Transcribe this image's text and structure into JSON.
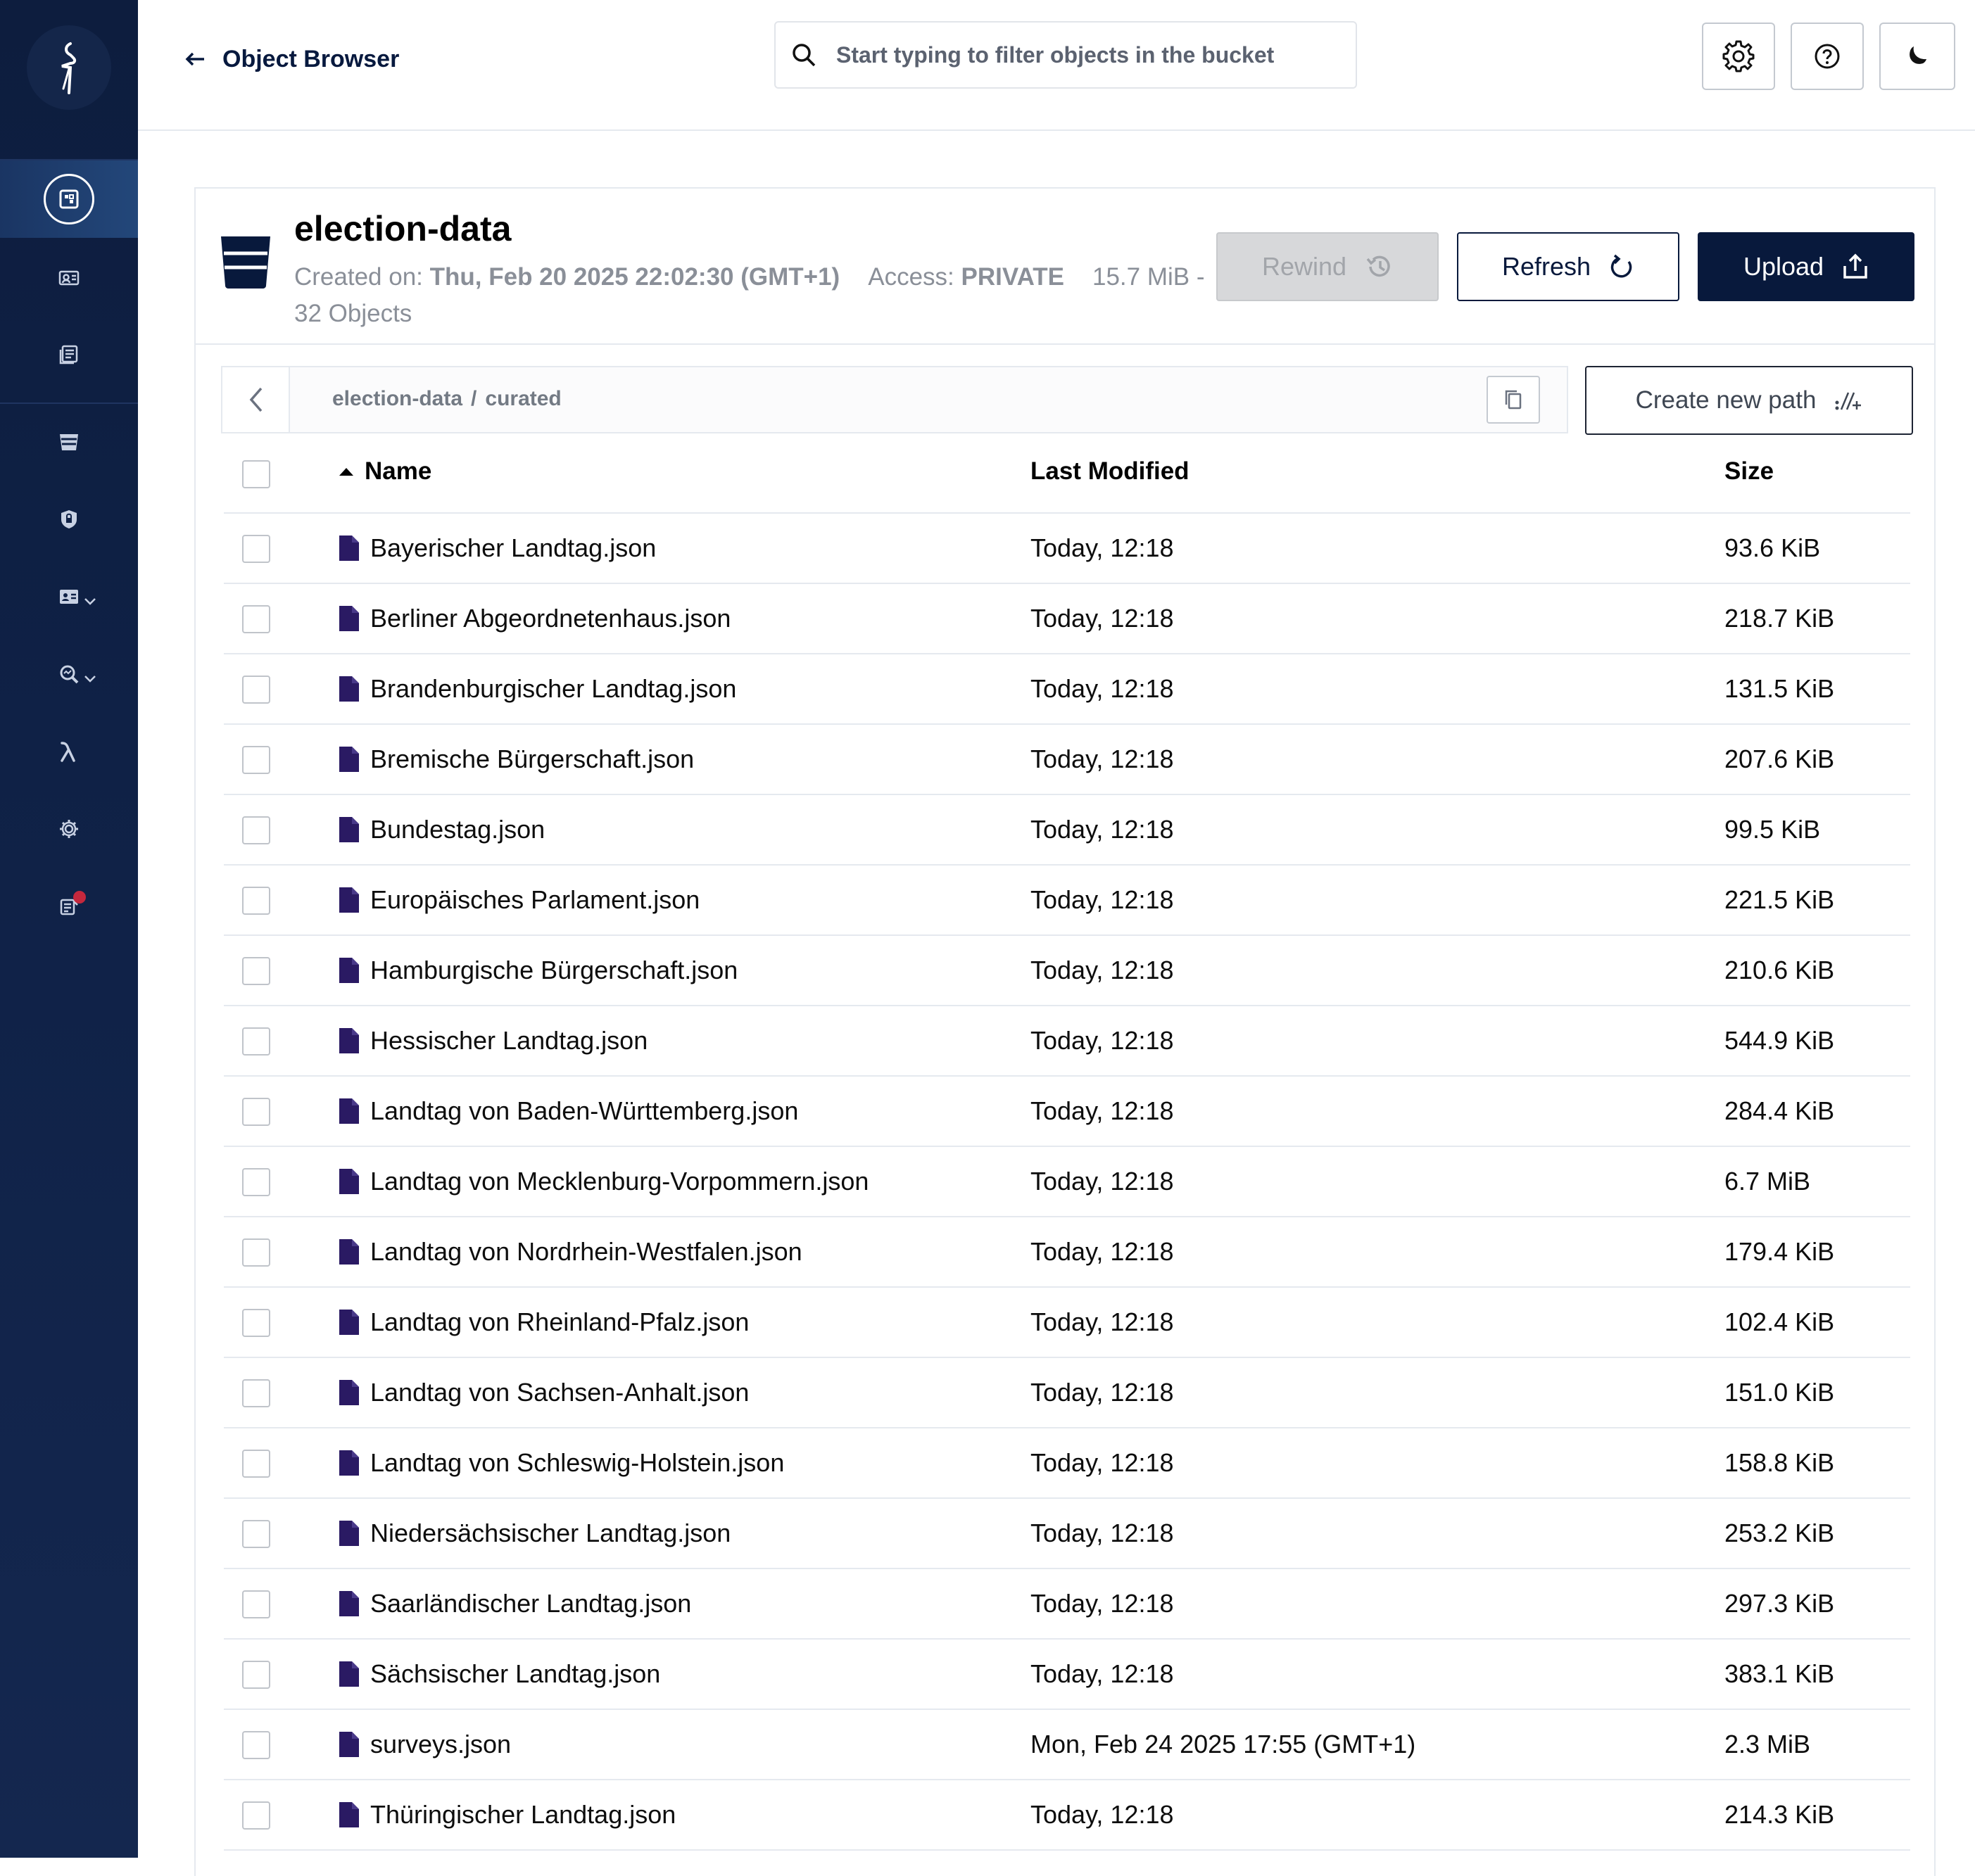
{
  "topbar": {
    "back_label": "Object Browser",
    "search_placeholder": "Start typing to filter objects in the bucket"
  },
  "bucket": {
    "name": "election-data",
    "created_label": "Created on:",
    "created_value": "Thu, Feb 20 2025 22:02:30 (GMT+1)",
    "access_label": "Access:",
    "access_value": "PRIVATE",
    "usage": "15.7 MiB - 32 Objects"
  },
  "actions": {
    "rewind": "Rewind",
    "refresh": "Refresh",
    "upload": "Upload",
    "create_path": "Create new path"
  },
  "breadcrumb": {
    "bucket": "election-data",
    "separator": "/",
    "folder": "curated"
  },
  "table": {
    "headers": {
      "name": "Name",
      "modified": "Last Modified",
      "size": "Size"
    },
    "rows": [
      {
        "name": "Bayerischer Landtag.json",
        "modified": "Today, 12:18",
        "size": "93.6 KiB"
      },
      {
        "name": "Berliner Abgeordnetenhaus.json",
        "modified": "Today, 12:18",
        "size": "218.7 KiB"
      },
      {
        "name": "Brandenburgischer Landtag.json",
        "modified": "Today, 12:18",
        "size": "131.5 KiB"
      },
      {
        "name": "Bremische Bürgerschaft.json",
        "modified": "Today, 12:18",
        "size": "207.6 KiB"
      },
      {
        "name": "Bundestag.json",
        "modified": "Today, 12:18",
        "size": "99.5 KiB"
      },
      {
        "name": "Europäisches Parlament.json",
        "modified": "Today, 12:18",
        "size": "221.5 KiB"
      },
      {
        "name": "Hamburgische Bürgerschaft.json",
        "modified": "Today, 12:18",
        "size": "210.6 KiB"
      },
      {
        "name": "Hessischer Landtag.json",
        "modified": "Today, 12:18",
        "size": "544.9 KiB"
      },
      {
        "name": "Landtag von Baden-Württemberg.json",
        "modified": "Today, 12:18",
        "size": "284.4 KiB"
      },
      {
        "name": "Landtag von Mecklenburg-Vorpommern.json",
        "modified": "Today, 12:18",
        "size": "6.7 MiB"
      },
      {
        "name": "Landtag von Nordrhein-Westfalen.json",
        "modified": "Today, 12:18",
        "size": "179.4 KiB"
      },
      {
        "name": "Landtag von Rheinland-Pfalz.json",
        "modified": "Today, 12:18",
        "size": "102.4 KiB"
      },
      {
        "name": "Landtag von Sachsen-Anhalt.json",
        "modified": "Today, 12:18",
        "size": "151.0 KiB"
      },
      {
        "name": "Landtag von Schleswig-Holstein.json",
        "modified": "Today, 12:18",
        "size": "158.8 KiB"
      },
      {
        "name": "Niedersächsischer Landtag.json",
        "modified": "Today, 12:18",
        "size": "253.2 KiB"
      },
      {
        "name": "Saarländischer Landtag.json",
        "modified": "Today, 12:18",
        "size": "297.3 KiB"
      },
      {
        "name": "Sächsischer Landtag.json",
        "modified": "Today, 12:18",
        "size": "383.1 KiB"
      },
      {
        "name": "surveys.json",
        "modified": "Mon, Feb 24 2025 17:55 (GMT+1)",
        "size": "2.3 MiB"
      },
      {
        "name": "Thüringischer Landtag.json",
        "modified": "Today, 12:18",
        "size": "214.3 KiB"
      }
    ]
  },
  "icons": {
    "sidebar": [
      "object-browser-icon",
      "access-keys-icon",
      "documentation-icon",
      "buckets-icon",
      "policies-icon",
      "identity-icon",
      "monitoring-icon",
      "lambda-icon",
      "configuration-icon",
      "license-icon"
    ],
    "file": "file-icon"
  },
  "colors": {
    "sidebar": "#0f2146",
    "primary": "#08193c",
    "file_icon": "#2a1a63",
    "notification": "#c5283d"
  }
}
